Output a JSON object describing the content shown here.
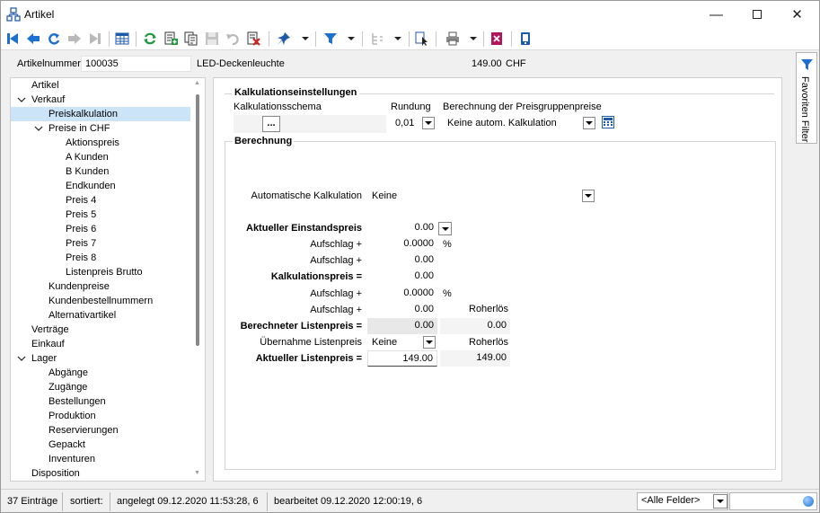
{
  "window": {
    "title": "Artikel"
  },
  "header": {
    "artikelnummer_label": "Artikelnummer",
    "artikelnummer_value": "100035",
    "description": "LED-Deckenleuchte",
    "price": "149.00",
    "currency": "CHF"
  },
  "tree": {
    "items": [
      {
        "label": "Artikel",
        "level": 0
      },
      {
        "label": "Verkauf",
        "level": 0,
        "expanded": true
      },
      {
        "label": "Preiskalkulation",
        "level": 1,
        "selected": true
      },
      {
        "label": "Preise in CHF",
        "level": 1,
        "expanded": true
      },
      {
        "label": "Aktionspreis",
        "level": 2
      },
      {
        "label": "A Kunden",
        "level": 2
      },
      {
        "label": "B Kunden",
        "level": 2
      },
      {
        "label": "Endkunden",
        "level": 2
      },
      {
        "label": "Preis 4",
        "level": 2
      },
      {
        "label": "Preis 5",
        "level": 2
      },
      {
        "label": "Preis 6",
        "level": 2
      },
      {
        "label": "Preis 7",
        "level": 2
      },
      {
        "label": "Preis 8",
        "level": 2
      },
      {
        "label": "Listenpreis Brutto",
        "level": 2
      },
      {
        "label": "Kundenpreise",
        "level": 1
      },
      {
        "label": "Kundenbestellnummern",
        "level": 1
      },
      {
        "label": "Alternativartikel",
        "level": 1
      },
      {
        "label": "Verträge",
        "level": 0
      },
      {
        "label": "Einkauf",
        "level": 0
      },
      {
        "label": "Lager",
        "level": 0,
        "expanded": true
      },
      {
        "label": "Abgänge",
        "level": 1
      },
      {
        "label": "Zugänge",
        "level": 1
      },
      {
        "label": "Bestellungen",
        "level": 1
      },
      {
        "label": "Produktion",
        "level": 1
      },
      {
        "label": "Reservierungen",
        "level": 1
      },
      {
        "label": "Gepackt",
        "level": 1
      },
      {
        "label": "Inventuren",
        "level": 1
      },
      {
        "label": "Disposition",
        "level": 0
      }
    ]
  },
  "kalk": {
    "title": "Kalkulationseinstellungen",
    "schema_label": "Kalkulationsschema",
    "schema_button": "...",
    "rundung_label": "Rundung",
    "rundung_value": "0,01",
    "preisgruppen_label": "Berechnung der Preisgruppenpreise",
    "preisgruppen_value": "Keine autom. Kalkulation"
  },
  "berechnung": {
    "title": "Berechnung",
    "auto_label": "Automatische Kalkulation",
    "auto_value": "Keine",
    "einstand_label": "Aktueller Einstandspreis",
    "einstand_value": "0.00",
    "aufschlag1_pct_label": "Aufschlag +",
    "aufschlag1_pct_value": "0.0000",
    "pct_sign": "%",
    "aufschlag1_abs_label": "Aufschlag +",
    "aufschlag1_abs_value": "0.00",
    "kalkpreis_label": "Kalkulationspreis =",
    "kalkpreis_value": "0.00",
    "aufschlag2_pct_label": "Aufschlag +",
    "aufschlag2_pct_value": "0.0000",
    "aufschlag2_abs_label": "Aufschlag +",
    "aufschlag2_abs_value": "0.00",
    "roherloes1_label": "Roherlös",
    "berechnet_label": "Berechneter Listenpreis =",
    "berechnet_value": "0.00",
    "roherloes1_value": "0.00",
    "uebernahme_label": "Übernahme Listenpreis",
    "uebernahme_value": "Keine",
    "roherloes2_label": "Roherlös",
    "aktuell_label": "Aktueller Listenpreis =",
    "aktuell_value": "149.00",
    "roherloes2_value": "149.00"
  },
  "sidetab": {
    "label": "Favoriten Filter"
  },
  "status": {
    "count": "37 Einträge",
    "sorted": "sortiert:",
    "created": "angelegt 09.12.2020 11:53:28,  6",
    "edited": "bearbeitet 09.12.2020 12:00:19,  6",
    "field_select": "<Alle Felder>"
  }
}
